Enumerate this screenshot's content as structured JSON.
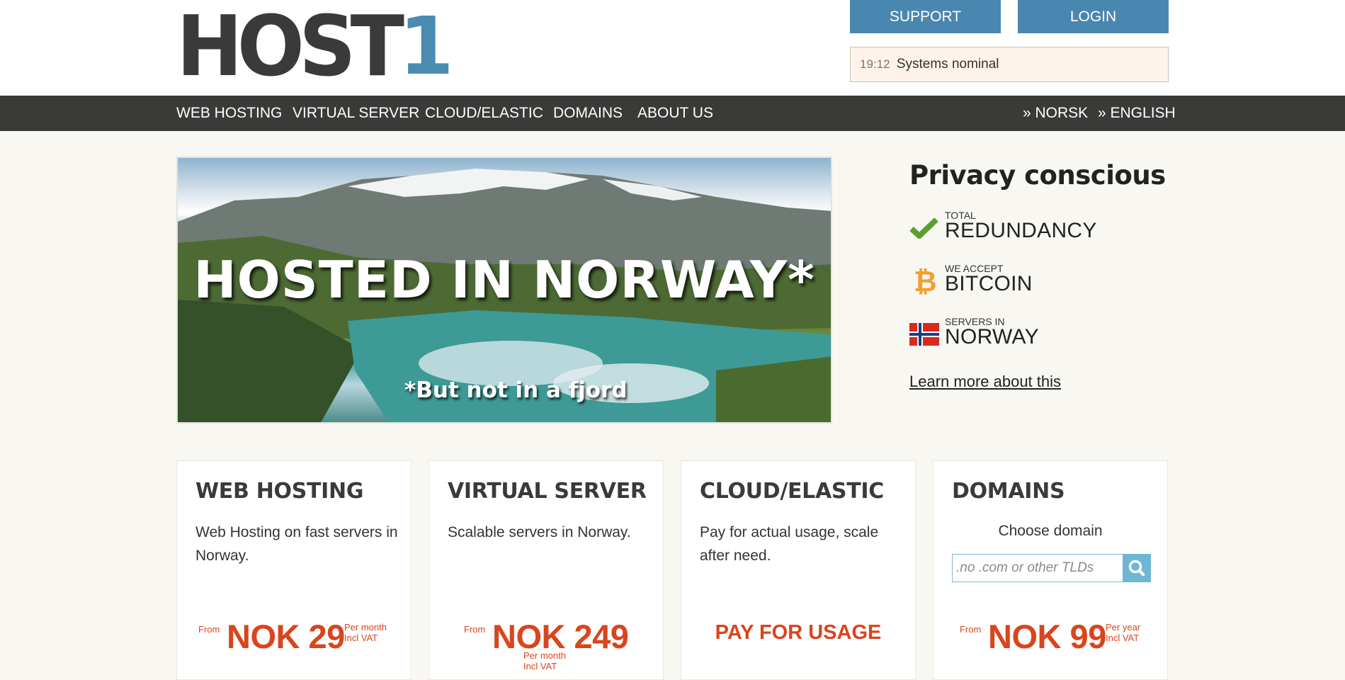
{
  "header": {
    "logo_text": "HOST1",
    "support_label": "SUPPORT",
    "login_label": "LOGIN",
    "status_time": "19:12",
    "status_text": "Systems nominal"
  },
  "nav": {
    "items": [
      "WEB HOSTING",
      "VIRTUAL SERVER",
      "CLOUD/ELASTIC",
      "DOMAINS",
      "ABOUT US"
    ],
    "lang_norsk": "» NORSK",
    "lang_english": "» ENGLISH"
  },
  "hero": {
    "title": "HOSTED IN NORWAY*",
    "subtitle": "*But not in a fjord"
  },
  "privacy": {
    "heading": "Privacy conscious",
    "features": [
      {
        "small": "TOTAL",
        "big": "REDUNDANCY",
        "icon": "check-icon"
      },
      {
        "small": "WE ACCEPT",
        "big": "BITCOIN",
        "icon": "bitcoin-icon"
      },
      {
        "small": "SERVERS IN",
        "big": "NORWAY",
        "icon": "norway-flag-icon"
      }
    ],
    "learn_more": "Learn more about this"
  },
  "cards": [
    {
      "title": "WEB HOSTING",
      "desc": "Web Hosting on fast servers in Norway.",
      "from": "From",
      "price": "NOK 29",
      "per1": "Per month",
      "per2": "Incl VAT"
    },
    {
      "title": "VIRTUAL SERVER",
      "desc": "Scalable servers in Norway.",
      "from": "From",
      "price": "NOK 249",
      "per1": "Per month",
      "per2": "Incl VAT"
    },
    {
      "title": "CLOUD/ELASTIC",
      "desc": "Pay for actual usage, scale after need.",
      "cta": "PAY FOR USAGE"
    },
    {
      "title": "DOMAINS",
      "label": "Choose domain",
      "placeholder": ".no .com or other TLDs",
      "from": "From",
      "price": "NOK 99",
      "per1": "Per year",
      "per2": "Incl VAT"
    }
  ],
  "colors": {
    "accent_blue": "#4a87b0",
    "price_orange": "#d9451e",
    "nav_dark": "#3a3a38",
    "check_green": "#5aa02c",
    "bitcoin_orange": "#f0a030"
  }
}
